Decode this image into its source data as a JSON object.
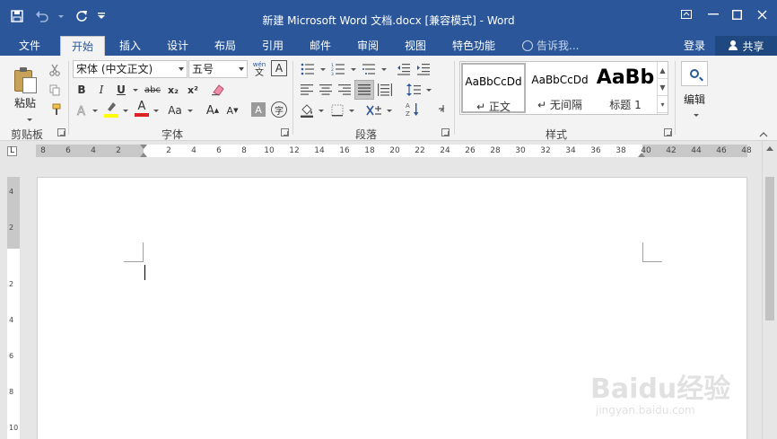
{
  "app": {
    "title": "新建 Microsoft Word 文档.docx [兼容模式] - Word"
  },
  "tabs": [
    {
      "label": "文件"
    },
    {
      "label": "开始"
    },
    {
      "label": "插入"
    },
    {
      "label": "设计"
    },
    {
      "label": "布局"
    },
    {
      "label": "引用"
    },
    {
      "label": "邮件"
    },
    {
      "label": "审阅"
    },
    {
      "label": "视图"
    },
    {
      "label": "特色功能"
    }
  ],
  "active_tab": "开始",
  "tellme": {
    "placeholder": "告诉我..."
  },
  "account": {
    "login": "登录",
    "share": "共享"
  },
  "clipboard": {
    "paste": "粘贴",
    "group_label": "剪贴板"
  },
  "font": {
    "name": "宋体 (中文正文)",
    "size": "五号",
    "group_label": "字体",
    "bold": "B",
    "italic": "I",
    "underline": "U",
    "strike": "abc",
    "sub": "x₂",
    "sup": "x²",
    "grow": "A",
    "shrink": "A",
    "case": "Aa",
    "color_a": "A",
    "phonetic": "wén",
    "phonetic_char": "文",
    "border_char": "A",
    "shading_char": "A",
    "enclose_char": "字"
  },
  "paragraph": {
    "group_label": "段落"
  },
  "styles": {
    "group_label": "样式",
    "items": [
      {
        "sample": "AaBbCcDd",
        "name": "正文"
      },
      {
        "sample": "AaBbCcDd",
        "name": "无间隔"
      },
      {
        "sample": "AaBb",
        "name": "标题 1"
      }
    ]
  },
  "editing": {
    "label": "编辑"
  },
  "ruler": {
    "left_ticks": [
      "8",
      "6",
      "4",
      "2"
    ],
    "right_ticks": [
      "2",
      "4",
      "6",
      "8",
      "10",
      "12",
      "14",
      "16",
      "18",
      "20",
      "22",
      "24",
      "26",
      "28",
      "30",
      "32",
      "34",
      "36",
      "38",
      "40",
      "42",
      "44",
      "46",
      "48"
    ],
    "corner": "L"
  },
  "vruler_ticks": [
    "4",
    "2",
    "2",
    "4",
    "6",
    "8",
    "10"
  ],
  "watermark": {
    "main": "Baidu经验",
    "sub": "jingyan.baidu.com"
  },
  "colors": {
    "brand": "#2b579a",
    "highlight": "#ffff00",
    "font_color": "#e02020"
  }
}
